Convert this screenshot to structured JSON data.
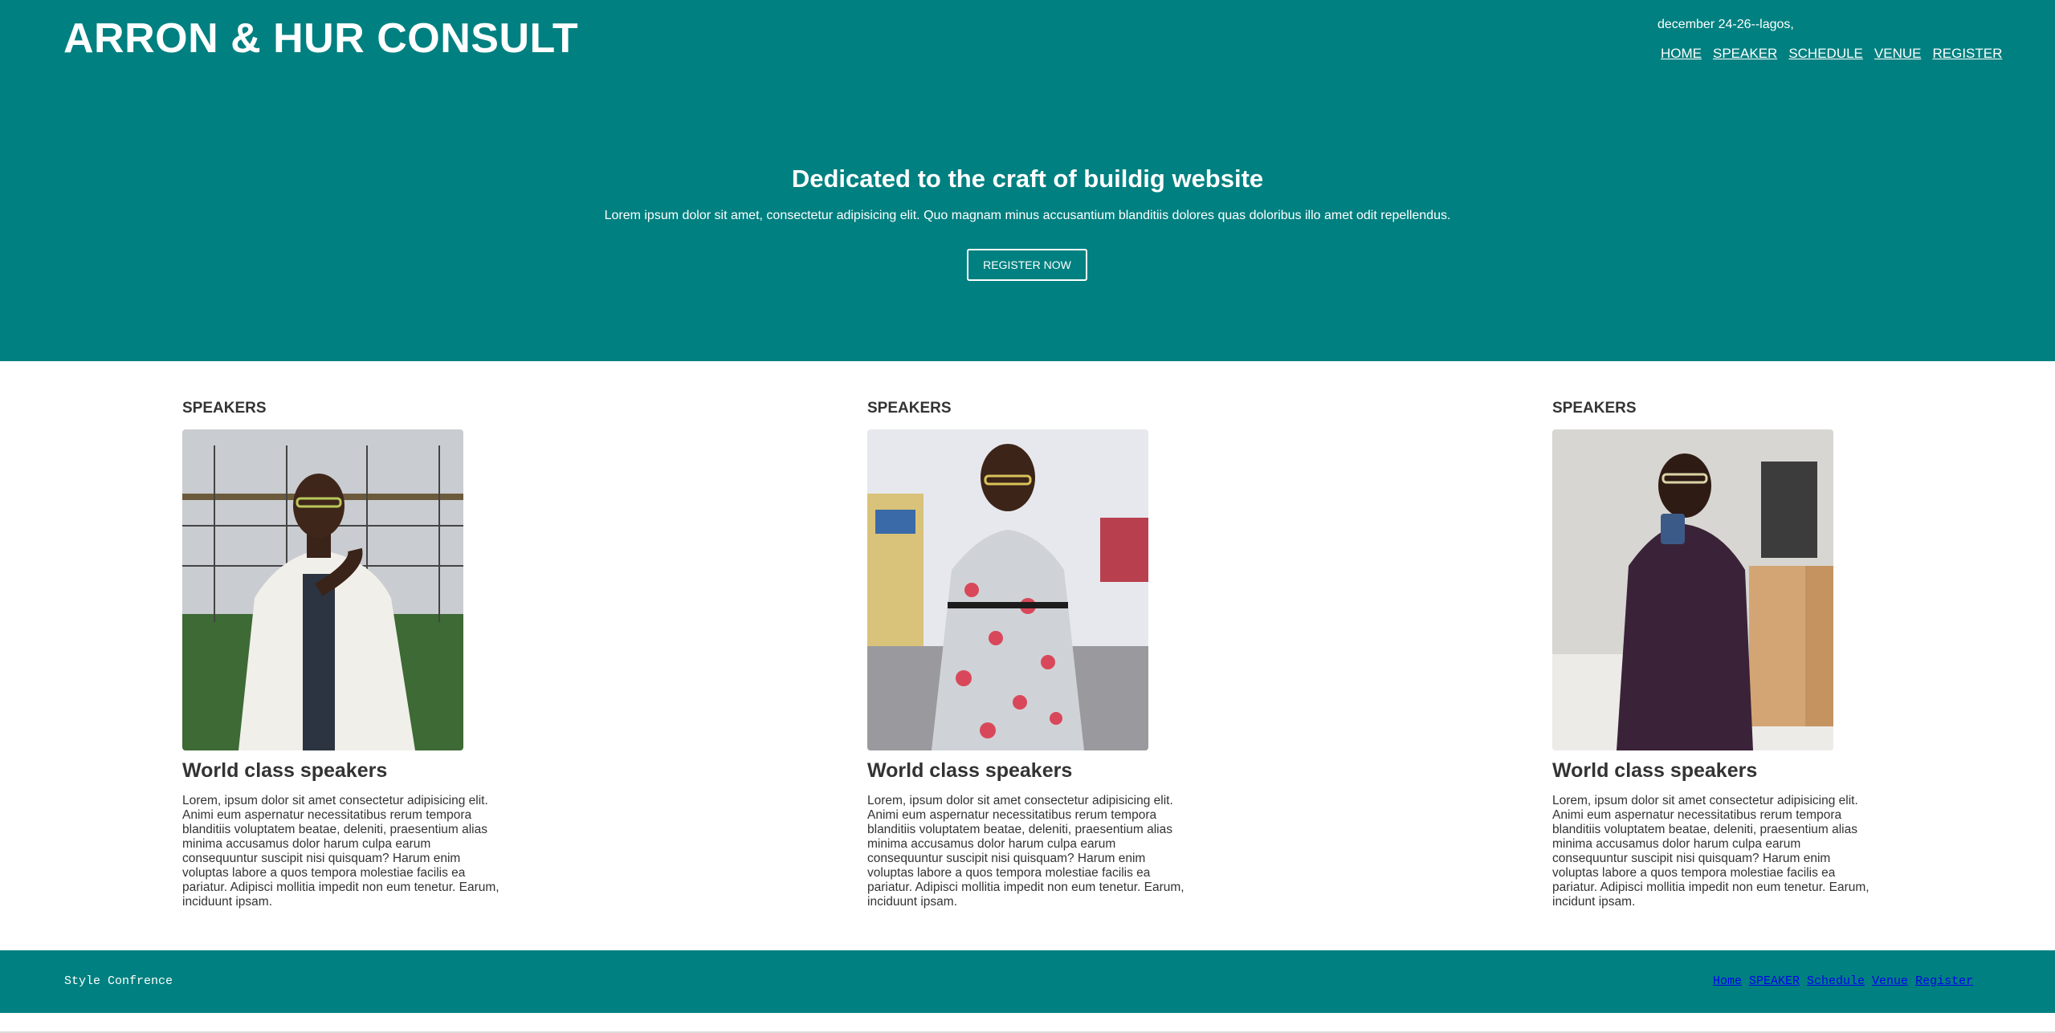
{
  "header": {
    "brand": "ARRON & HUR CONSULT",
    "date": "december 24-26--lagos,",
    "nav": [
      "HOME",
      "SPEAKER",
      "SCHEDULE",
      "VENUE",
      "REGISTER"
    ]
  },
  "hero": {
    "title": "Dedicated to the craft of buildig website",
    "subtitle": "Lorem ipsum dolor sit amet, consectetur adipisicing elit. Quo magnam minus accusantium blanditiis dolores quas doloribus illo amet odit repellendus.",
    "cta": "REGISTER NOW"
  },
  "speakers": [
    {
      "heading": "SPEAKERS",
      "title": "World class speakers",
      "text": "Lorem, ipsum dolor sit amet consectetur adipisicing elit. Animi eum aspernatur necessitatibus rerum tempora blanditiis voluptatem beatae, deleniti, praesentium alias minima accusamus dolor harum culpa earum consequuntur suscipit nisi quisquam? Harum enim voluptas labore a quos tempora molestiae facilis ea pariatur. Adipisci mollitia impedit non eum tenetur. Earum, inciduunt ipsam."
    },
    {
      "heading": "SPEAKERS",
      "title": "World class speakers",
      "text": "Lorem, ipsum dolor sit amet consectetur adipisicing elit. Animi eum aspernatur necessitatibus rerum tempora blanditiis voluptatem beatae, deleniti, praesentium alias minima accusamus dolor harum culpa earum consequuntur suscipit nisi quisquam? Harum enim voluptas labore a quos tempora molestiae facilis ea pariatur. Adipisci mollitia impedit non eum tenetur. Earum, inciduunt ipsam."
    },
    {
      "heading": "SPEAKERS",
      "title": "World class speakers",
      "text": "Lorem, ipsum dolor sit amet consectetur adipisicing elit. Animi eum aspernatur necessitatibus rerum tempora blanditiis voluptatem beatae, deleniti, praesentium alias minima accusamus dolor harum culpa earum consequuntur suscipit nisi quisquam? Harum enim voluptas labore a quos tempora molestiae facilis ea pariatur. Adipisci mollitia impedit non eum tenetur. Earum, incidunt ipsam."
    }
  ],
  "footer": {
    "brand": "Style Confrence",
    "nav": [
      "Home",
      "SPEAKER",
      "Schedule",
      "Venue",
      "Register"
    ]
  },
  "colors": {
    "brand_teal": "#008080",
    "text_dark": "#333333",
    "footer_link": "#0000ee"
  }
}
